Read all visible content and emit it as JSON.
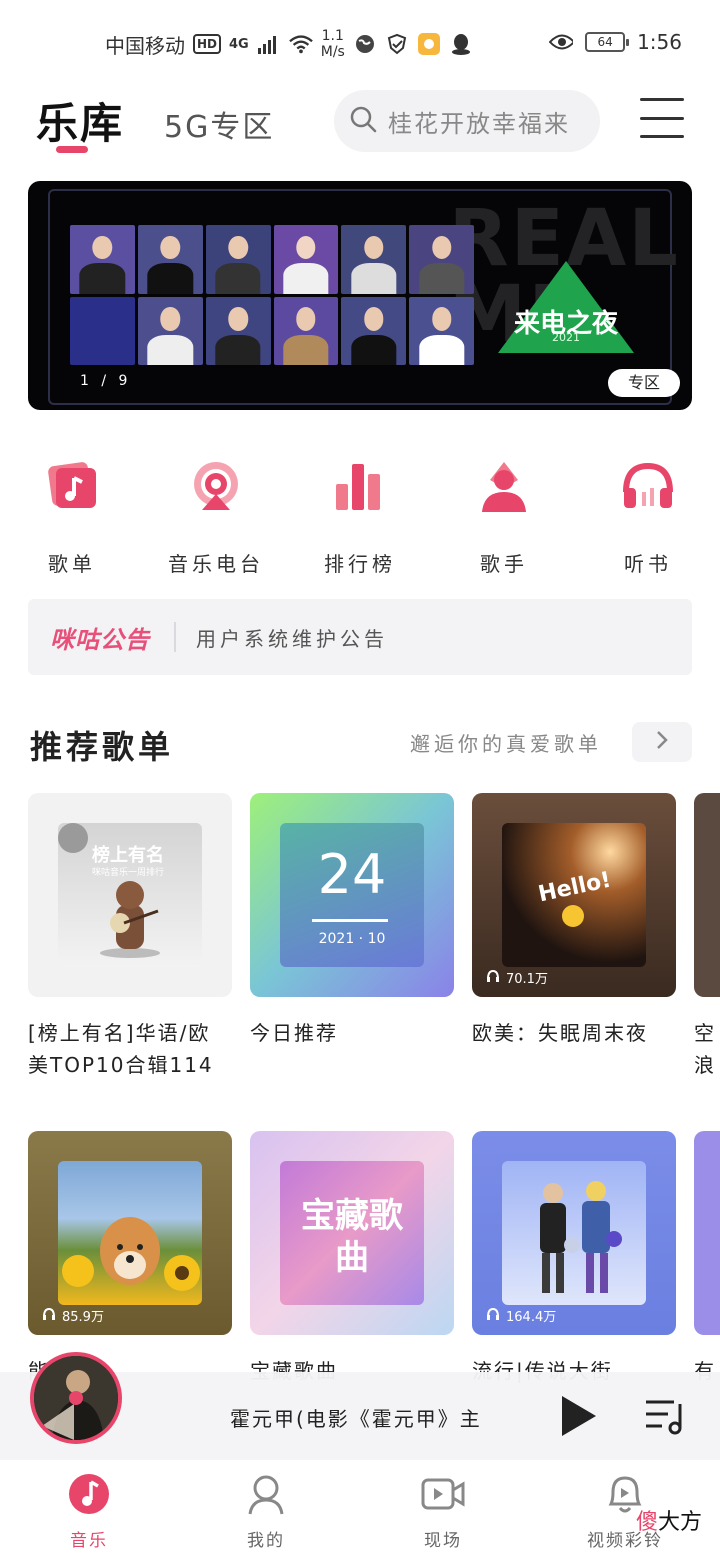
{
  "status_bar": {
    "carrier": "中国移动",
    "hd_badge": "HD",
    "network": "4G",
    "speed": "1.1\nM/s",
    "battery": "64",
    "time": "1:56"
  },
  "header": {
    "tab_music": "乐库",
    "tab_5g": "5G专区",
    "search_placeholder": "桂花开放幸福来"
  },
  "banner": {
    "brand_text": "REAL ME",
    "event_title": "来电之夜",
    "event_year": "2021",
    "counter": "1 / 9",
    "badge": "专区"
  },
  "categories": [
    {
      "label": "歌单",
      "icon": "playlist-icon"
    },
    {
      "label": "音乐电台",
      "icon": "radio-icon"
    },
    {
      "label": "排行榜",
      "icon": "chart-icon"
    },
    {
      "label": "歌手",
      "icon": "singer-icon"
    },
    {
      "label": "听书",
      "icon": "headphones-icon"
    }
  ],
  "notice": {
    "brand": "咪咕公告",
    "text": "用户系统维护公告"
  },
  "recommend": {
    "title": "推荐歌单",
    "subtitle": "邂逅你的真爱歌单"
  },
  "playlists_row1": [
    {
      "title": "[榜上有名]华语/欧美TOP10合辑114",
      "plays": "",
      "cover_title": "榜上有名",
      "cover_sub": "咪咕音乐一周排行"
    },
    {
      "title": "今日推荐",
      "plays": "",
      "cover_title": "24",
      "cover_sub": "2021 · 10"
    },
    {
      "title": "欧美：失眠周末夜",
      "plays": "70.1万",
      "cover_title": "Hello!",
      "cover_sub": ""
    },
    {
      "title": "空浪",
      "plays": "",
      "cover_title": "",
      "cover_sub": ""
    }
  ],
  "playlists_row2": [
    {
      "title": "能…金…",
      "plays": "85.9万"
    },
    {
      "title": "宝藏歌曲",
      "plays": "",
      "cover_title": "宝藏歌曲"
    },
    {
      "title": "流行|传说大街",
      "plays": "164.4万"
    },
    {
      "title": "有",
      "plays": ""
    }
  ],
  "player": {
    "now_playing": "霍元甲(电影《霍元甲》主"
  },
  "nav": [
    {
      "label": "音乐",
      "active": true
    },
    {
      "label": "我的",
      "active": false
    },
    {
      "label": "现场",
      "active": false
    },
    {
      "label": "视频彩铃",
      "active": false
    }
  ],
  "watermark": {
    "a": "傻",
    "b": "大方"
  },
  "colors": {
    "accent": "#e8456a",
    "text": "#222222",
    "muted": "#888888"
  }
}
